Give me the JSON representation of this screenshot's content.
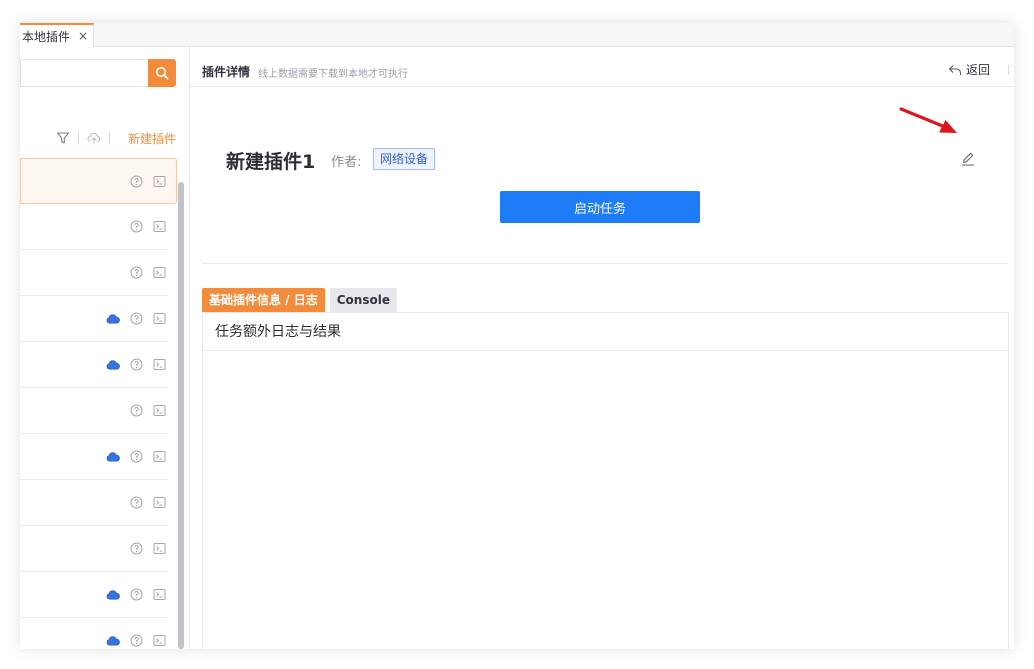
{
  "tab": {
    "label": "本地插件",
    "close": "×"
  },
  "sidebar": {
    "search": {
      "value": "",
      "placeholder": ""
    },
    "new_plugin_label": "新建插件",
    "items": [
      {
        "active": true,
        "cloud": false
      },
      {
        "active": false,
        "cloud": false
      },
      {
        "active": false,
        "cloud": false
      },
      {
        "active": false,
        "cloud": true
      },
      {
        "active": false,
        "cloud": true
      },
      {
        "active": false,
        "cloud": false
      },
      {
        "active": false,
        "cloud": true
      },
      {
        "active": false,
        "cloud": false
      },
      {
        "active": false,
        "cloud": false
      },
      {
        "active": false,
        "cloud": true
      },
      {
        "active": false,
        "cloud": true
      }
    ]
  },
  "main": {
    "header_title": "插件详情",
    "header_sub": "线上数据需要下载到本地才可执行",
    "back_label": "返回",
    "plugin_name": "新建插件1",
    "author_label": "作者:",
    "author_tag": "网络设备",
    "start_label": "启动任务",
    "tabs": [
      {
        "label": "基础插件信息 / 日志"
      },
      {
        "label": "Console"
      }
    ],
    "panel_title": "任务额外日志与结果"
  },
  "colors": {
    "accent": "#f28b3c",
    "primary": "#1f7cf7",
    "tag": "#3261c8",
    "annotation": "#e0161c",
    "cloud": "#3574e0"
  }
}
